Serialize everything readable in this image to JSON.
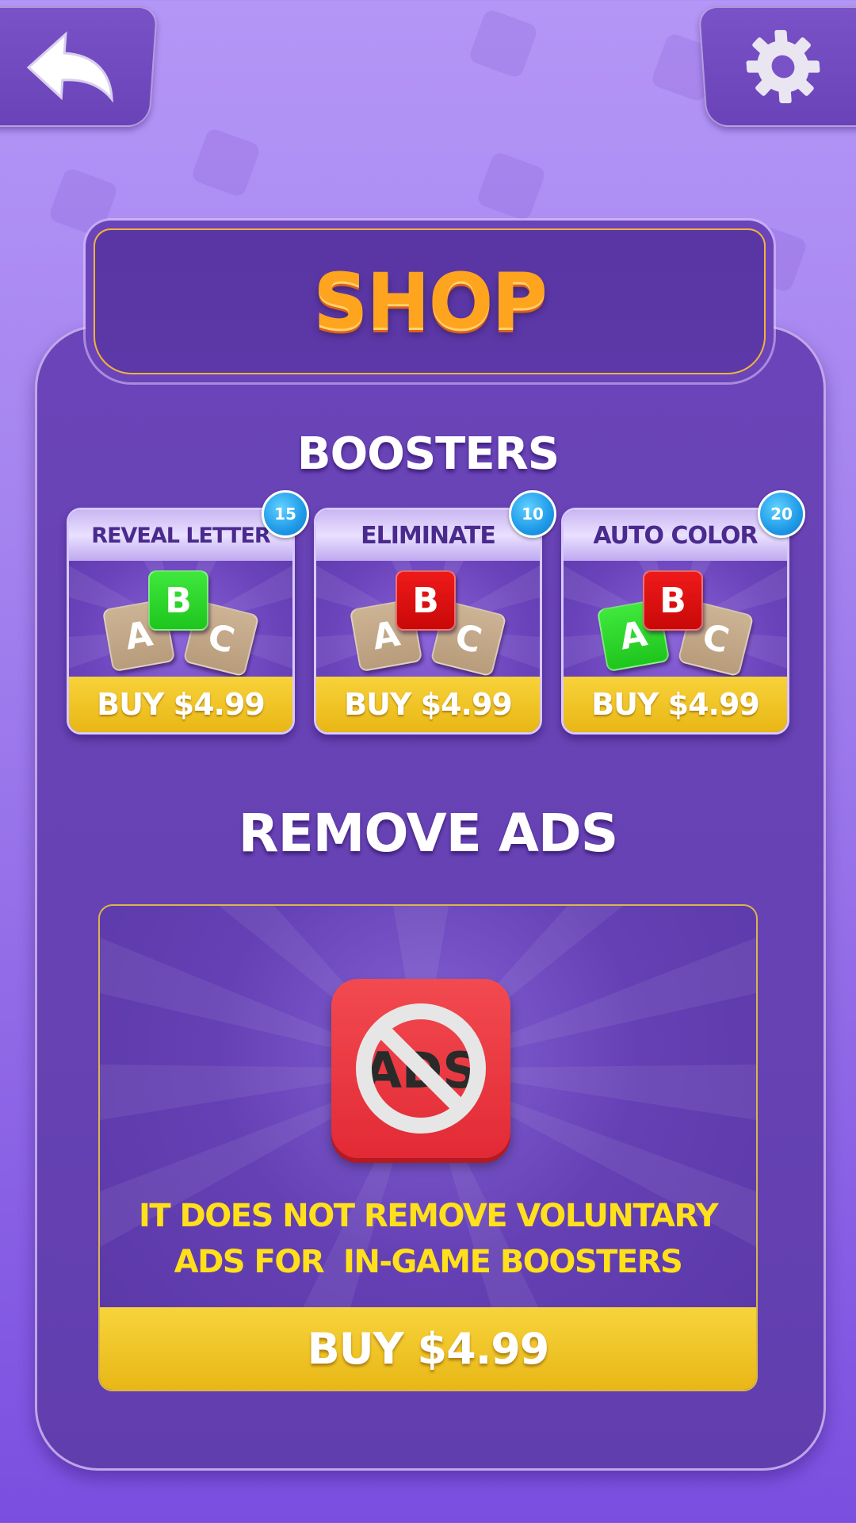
{
  "header": {
    "title": "SHOP"
  },
  "boosters": {
    "title": "BOOSTERS",
    "items": [
      {
        "label": "REVEAL LETTER",
        "count": "15",
        "buy_label": "BUY $4.99",
        "tiles": [
          "A",
          "B",
          "C"
        ],
        "highlight_color": "#1ec51d"
      },
      {
        "label": "ELIMINATE",
        "count": "10",
        "buy_label": "BUY $4.99",
        "tiles": [
          "A",
          "B",
          "C"
        ],
        "highlight_color": "#d40a0a"
      },
      {
        "label": "AUTO COLOR",
        "count": "20",
        "buy_label": "BUY $4.99",
        "tiles": [
          "A",
          "B",
          "C"
        ],
        "highlight_color": "#d40a0a"
      }
    ]
  },
  "remove_ads": {
    "title": "REMOVE ADS",
    "icon_text": "ADS",
    "note_line1": "IT DOES NOT REMOVE VOLUNTARY",
    "note_line2": "ADS FOR  IN-GAME BOOSTERS",
    "buy_label": "BUY $4.99"
  },
  "colors": {
    "background": "#a483ef",
    "panel": "#6642b3",
    "title_orange": "#ffa41f",
    "buy_yellow": "#f0c420",
    "note_yellow": "#ffe01b",
    "badge_blue": "#1f9ae8"
  },
  "icons": {
    "back": "back-arrow-icon",
    "settings": "gear-icon",
    "no_ads": "no-ads-icon"
  }
}
